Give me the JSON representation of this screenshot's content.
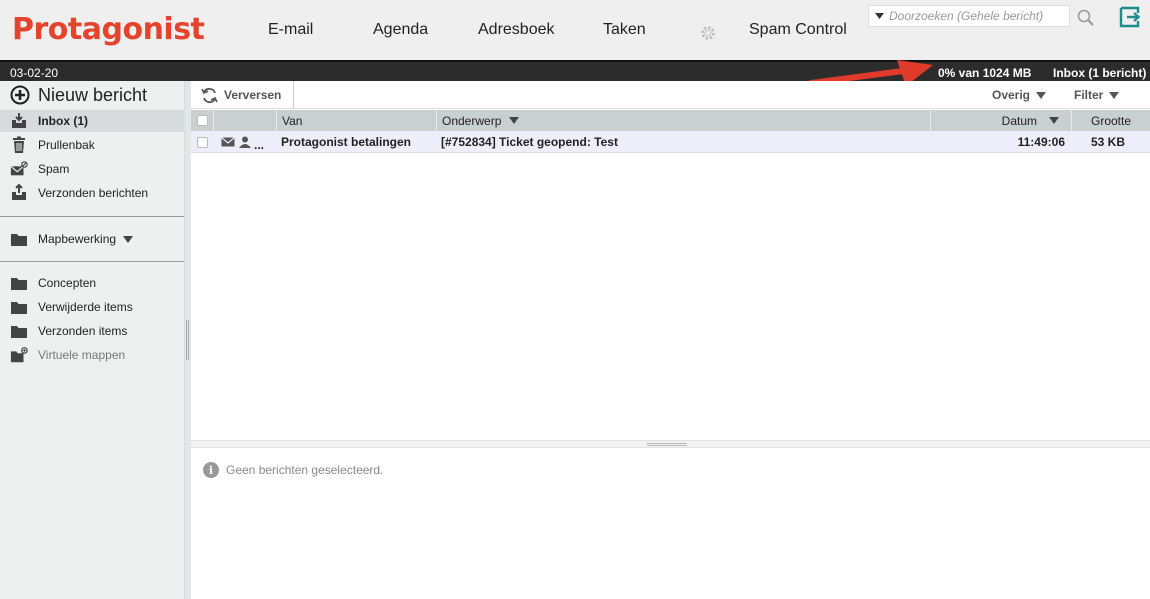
{
  "brand": {
    "name": "Protagonist",
    "color": "#e5432c"
  },
  "nav": {
    "items": [
      {
        "label": "E-mail"
      },
      {
        "label": "Agenda"
      },
      {
        "label": "Adresboek"
      },
      {
        "label": "Taken"
      },
      {
        "label": "Spam Control"
      }
    ],
    "settings_icon": "gear-icon"
  },
  "search": {
    "placeholder": "Doorzoeken (Gehele bericht)",
    "value": ""
  },
  "status": {
    "date": "03-02-20",
    "quota": "0% van 1024 MB",
    "folder": "Inbox (1 bericht)"
  },
  "sidebar": {
    "new_message": "Nieuw bericht",
    "items": [
      {
        "label": "Inbox (1)",
        "icon": "inbox-icon",
        "active": true
      },
      {
        "label": "Prullenbak",
        "icon": "trash-icon"
      },
      {
        "label": "Spam",
        "icon": "spam-icon"
      },
      {
        "label": "Verzonden berichten",
        "icon": "sent-icon"
      }
    ],
    "folder_edit": "Mapbewerking",
    "folders": [
      {
        "label": "Concepten",
        "icon": "folder-icon"
      },
      {
        "label": "Verwijderde items",
        "icon": "folder-icon"
      },
      {
        "label": "Verzonden items",
        "icon": "folder-icon"
      },
      {
        "label": "Virtuele mappen",
        "icon": "virtual-folder-icon"
      }
    ]
  },
  "toolbar": {
    "refresh": "Verversen",
    "more": "Overig",
    "filter": "Filter"
  },
  "columns": {
    "from": "Van",
    "subject": "Onderwerp",
    "date": "Datum",
    "size": "Grootte"
  },
  "messages": [
    {
      "from": "Protagonist betalingen",
      "subject": "[#752834] Ticket geopend: Test",
      "date": "11:49:06",
      "size": "53 KB",
      "more": "..."
    }
  ],
  "preview": {
    "empty_text": "Geen berichten geselecteerd."
  },
  "colors": {
    "accent_arrow": "#e03a2b",
    "status_bar": "#2c2c2c",
    "grid_header": "#c9d0d0",
    "row_unread": "#eeeefa",
    "sidebar_bg": "#eef0f0"
  }
}
